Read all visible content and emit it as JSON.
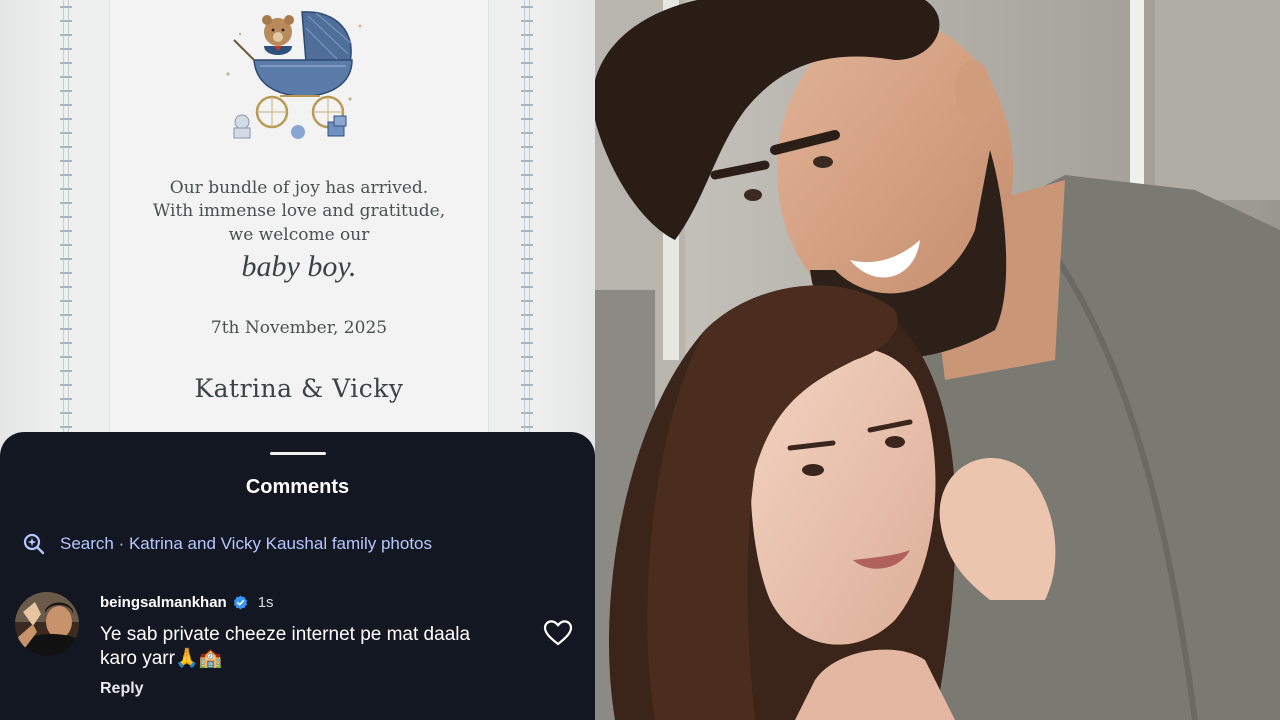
{
  "invitation": {
    "line1": "Our bundle of joy has arrived.",
    "line2": "With immense love and gratitude,",
    "line3": "we welcome our",
    "highlight": "baby boy.",
    "date": "7th November, 2025",
    "names": "Katrina & Vicky"
  },
  "comments_sheet": {
    "title": "Comments",
    "search_text": "Search · Katrina and Vicky Kaushal family photos",
    "comment": {
      "username": "beingsalmankhan",
      "verified": true,
      "time": "1s",
      "text": "Ye sab private cheeze internet pe mat daala karo yarr🙏🏫",
      "reply_label": "Reply"
    }
  },
  "colors": {
    "sheet_background": "#121722",
    "search_text": "#b6c6ff",
    "verified_badge": "#3897f0",
    "invitation_background": "#f2f3f2"
  },
  "icons": [
    "teddy-stroller-illustration-icon",
    "search-sparkle-icon",
    "verified-badge-icon",
    "heart-icon"
  ]
}
